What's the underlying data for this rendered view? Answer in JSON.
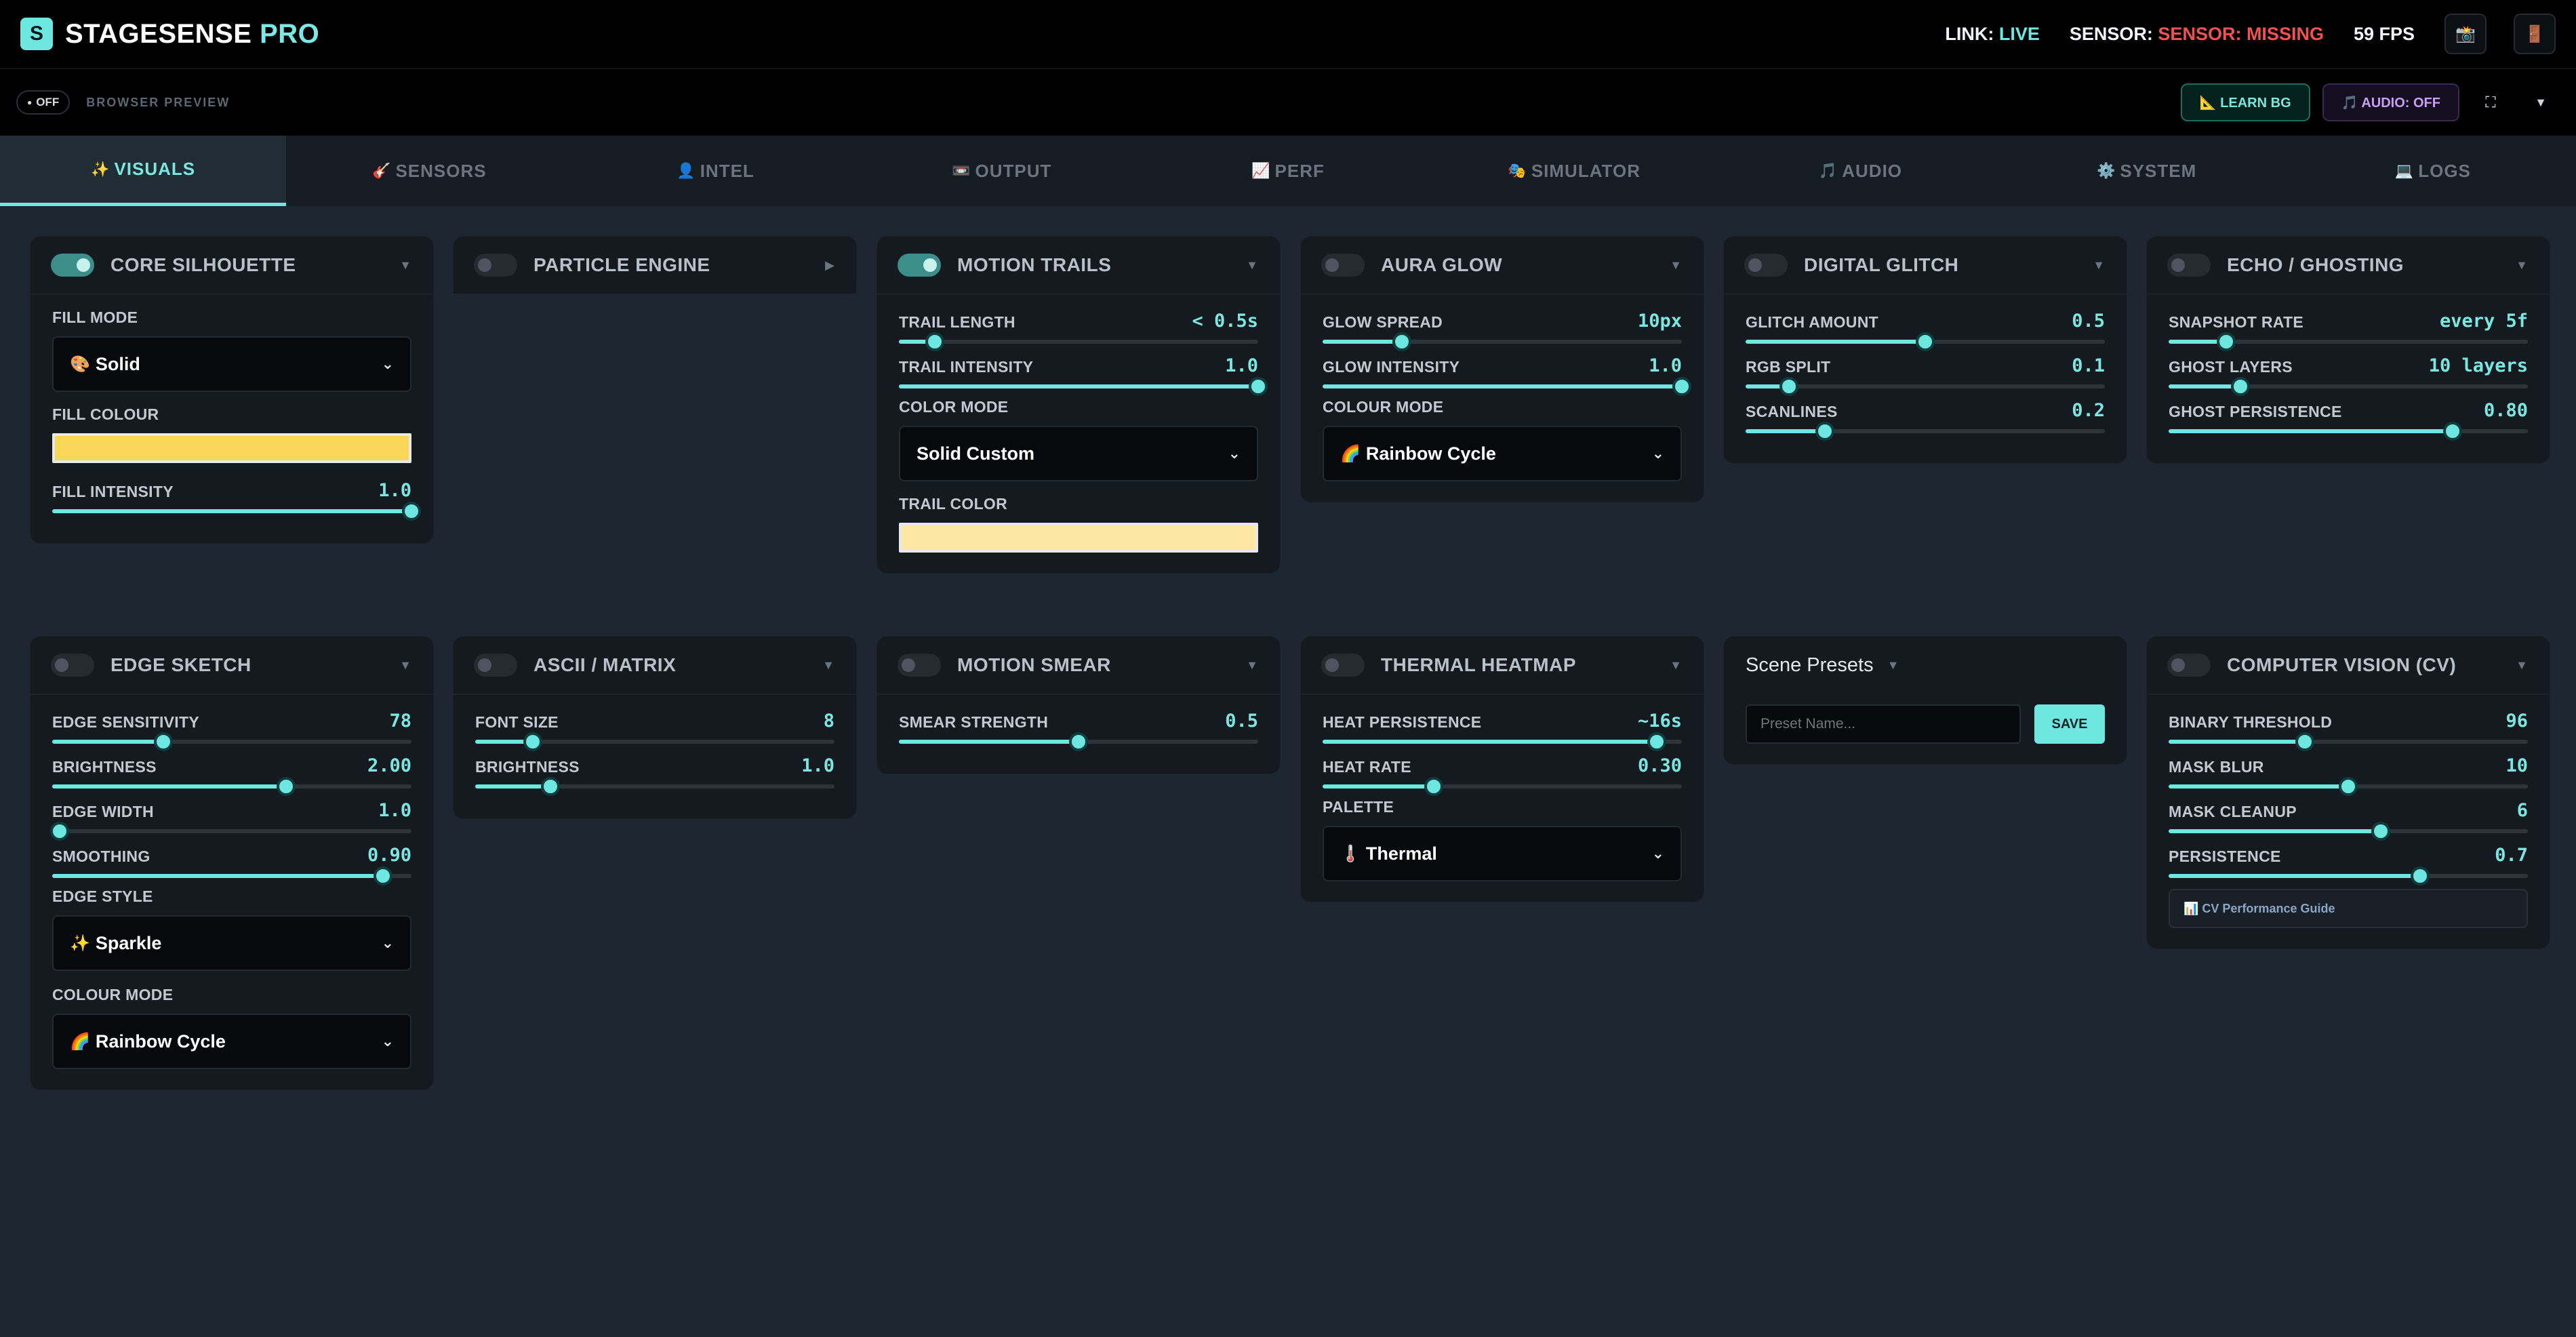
{
  "header": {
    "logo_letter": "S",
    "title_a": "STAGESENSE",
    "title_b": "PRO",
    "link_label": "LINK:",
    "link_value": "LIVE",
    "sensor_label": "SENSOR:",
    "sensor_value": "SENSOR: MISSING",
    "fps": "59 FPS",
    "btn1_icon": "📸",
    "btn2_icon": "🚪"
  },
  "subbar": {
    "off_label": "OFF",
    "preview_label": "BROWSER PREVIEW",
    "learn_bg": "📐 LEARN BG",
    "audio_off": "🎵 AUDIO: OFF",
    "fullscreen_icon": "⛶",
    "more_icon": "▼"
  },
  "tabs": [
    {
      "icon": "✨",
      "label": "VISUALS"
    },
    {
      "icon": "🎸",
      "label": "SENSORS"
    },
    {
      "icon": "👤",
      "label": "INTEL"
    },
    {
      "icon": "📼",
      "label": "OUTPUT"
    },
    {
      "icon": "📈",
      "label": "PERF"
    },
    {
      "icon": "🎭",
      "label": "SIMULATOR"
    },
    {
      "icon": "🎵",
      "label": "AUDIO"
    },
    {
      "icon": "⚙️",
      "label": "SYSTEM"
    },
    {
      "icon": "💻",
      "label": "LOGS"
    }
  ],
  "panels": {
    "core": {
      "title": "CORE SILHOUETTE",
      "caret": "▼",
      "fill_mode_label": "FILL MODE",
      "fill_mode_icon": "🎨",
      "fill_mode": "Solid",
      "fill_colour_label": "FILL COLOUR",
      "fill_colour": "#f9d65a",
      "fill_intensity_label": "FILL INTENSITY",
      "fill_intensity": "1.0",
      "fill_intensity_pos": 1.0
    },
    "particle": {
      "title": "PARTICLE ENGINE",
      "caret": "▶"
    },
    "trails": {
      "title": "MOTION TRAILS",
      "caret": "▼",
      "length_label": "TRAIL LENGTH",
      "length": "< 0.5s",
      "length_pos": 0.1,
      "intensity_label": "TRAIL INTENSITY",
      "intensity": "1.0",
      "intensity_pos": 1.0,
      "color_mode_label": "COLOR MODE",
      "color_mode": "Solid Custom",
      "trail_color_label": "TRAIL COLOR",
      "trail_color": "#fde7a3"
    },
    "aura": {
      "title": "AURA GLOW",
      "caret": "▼",
      "spread_label": "GLOW SPREAD",
      "spread": "10px",
      "spread_pos": 0.22,
      "intensity_label": "GLOW INTENSITY",
      "intensity": "1.0",
      "intensity_pos": 1.0,
      "colour_mode_label": "COLOUR MODE",
      "colour_mode_icon": "🌈",
      "colour_mode": "Rainbow Cycle"
    },
    "glitch": {
      "title": "DIGITAL GLITCH",
      "caret": "▼",
      "amount_label": "GLITCH AMOUNT",
      "amount": "0.5",
      "amount_pos": 0.5,
      "rgb_label": "RGB SPLIT",
      "rgb": "0.1",
      "rgb_pos": 0.12,
      "scan_label": "SCANLINES",
      "scan": "0.2",
      "scan_pos": 0.22
    },
    "echo": {
      "title": "ECHO / GHOSTING",
      "caret": "▼",
      "rate_label": "SNAPSHOT RATE",
      "rate": "every 5f",
      "rate_pos": 0.16,
      "layers_label": "GHOST LAYERS",
      "layers": "10 layers",
      "layers_pos": 0.2,
      "persist_label": "GHOST PERSISTENCE",
      "persist": "0.80",
      "persist_pos": 0.79
    },
    "edge": {
      "title": "EDGE SKETCH",
      "caret": "▼",
      "sens_label": "EDGE SENSITIVITY",
      "sens": "78",
      "sens_pos": 0.31,
      "bright_label": "BRIGHTNESS",
      "bright": "2.00",
      "bright_pos": 0.65,
      "width_label": "EDGE WIDTH",
      "width": "1.0",
      "width_pos": 0.02,
      "smooth_label": "SMOOTHING",
      "smooth": "0.90",
      "smooth_pos": 0.92,
      "style_label": "EDGE STYLE",
      "style_icon": "✨",
      "style": "Sparkle",
      "colour_label": "COLOUR MODE",
      "colour_icon": "🌈",
      "colour": "Rainbow Cycle"
    },
    "ascii": {
      "title": "ASCII / MATRIX",
      "caret": "▼",
      "font_label": "FONT SIZE",
      "font": "8",
      "font_pos": 0.16,
      "bright_label": "BRIGHTNESS",
      "bright": "1.0",
      "bright_pos": 0.21
    },
    "smear": {
      "title": "MOTION SMEAR",
      "caret": "▼",
      "strength_label": "SMEAR STRENGTH",
      "strength": "0.5",
      "strength_pos": 0.5
    },
    "thermal": {
      "title": "THERMAL HEATMAP",
      "caret": "▼",
      "persist_label": "HEAT PERSISTENCE",
      "persist": "~16s",
      "persist_pos": 0.93,
      "rate_label": "HEAT RATE",
      "rate": "0.30",
      "rate_pos": 0.31,
      "palette_label": "PALETTE",
      "palette_icon": "🌡️",
      "palette": "Thermal"
    },
    "presets": {
      "title": "Scene Presets",
      "caret": "▼",
      "placeholder": "Preset Name...",
      "save": "SAVE"
    },
    "cv": {
      "title": "COMPUTER VISION (CV)",
      "caret": "▼",
      "thresh_label": "BINARY THRESHOLD",
      "thresh": "96",
      "thresh_pos": 0.38,
      "blur_label": "MASK BLUR",
      "blur": "10",
      "blur_pos": 0.5,
      "clean_label": "MASK CLEANUP",
      "clean": "6",
      "clean_pos": 0.59,
      "persist_label": "PERSISTENCE",
      "persist": "0.7",
      "persist_pos": 0.7,
      "guide": "📊 CV Performance Guide"
    }
  }
}
